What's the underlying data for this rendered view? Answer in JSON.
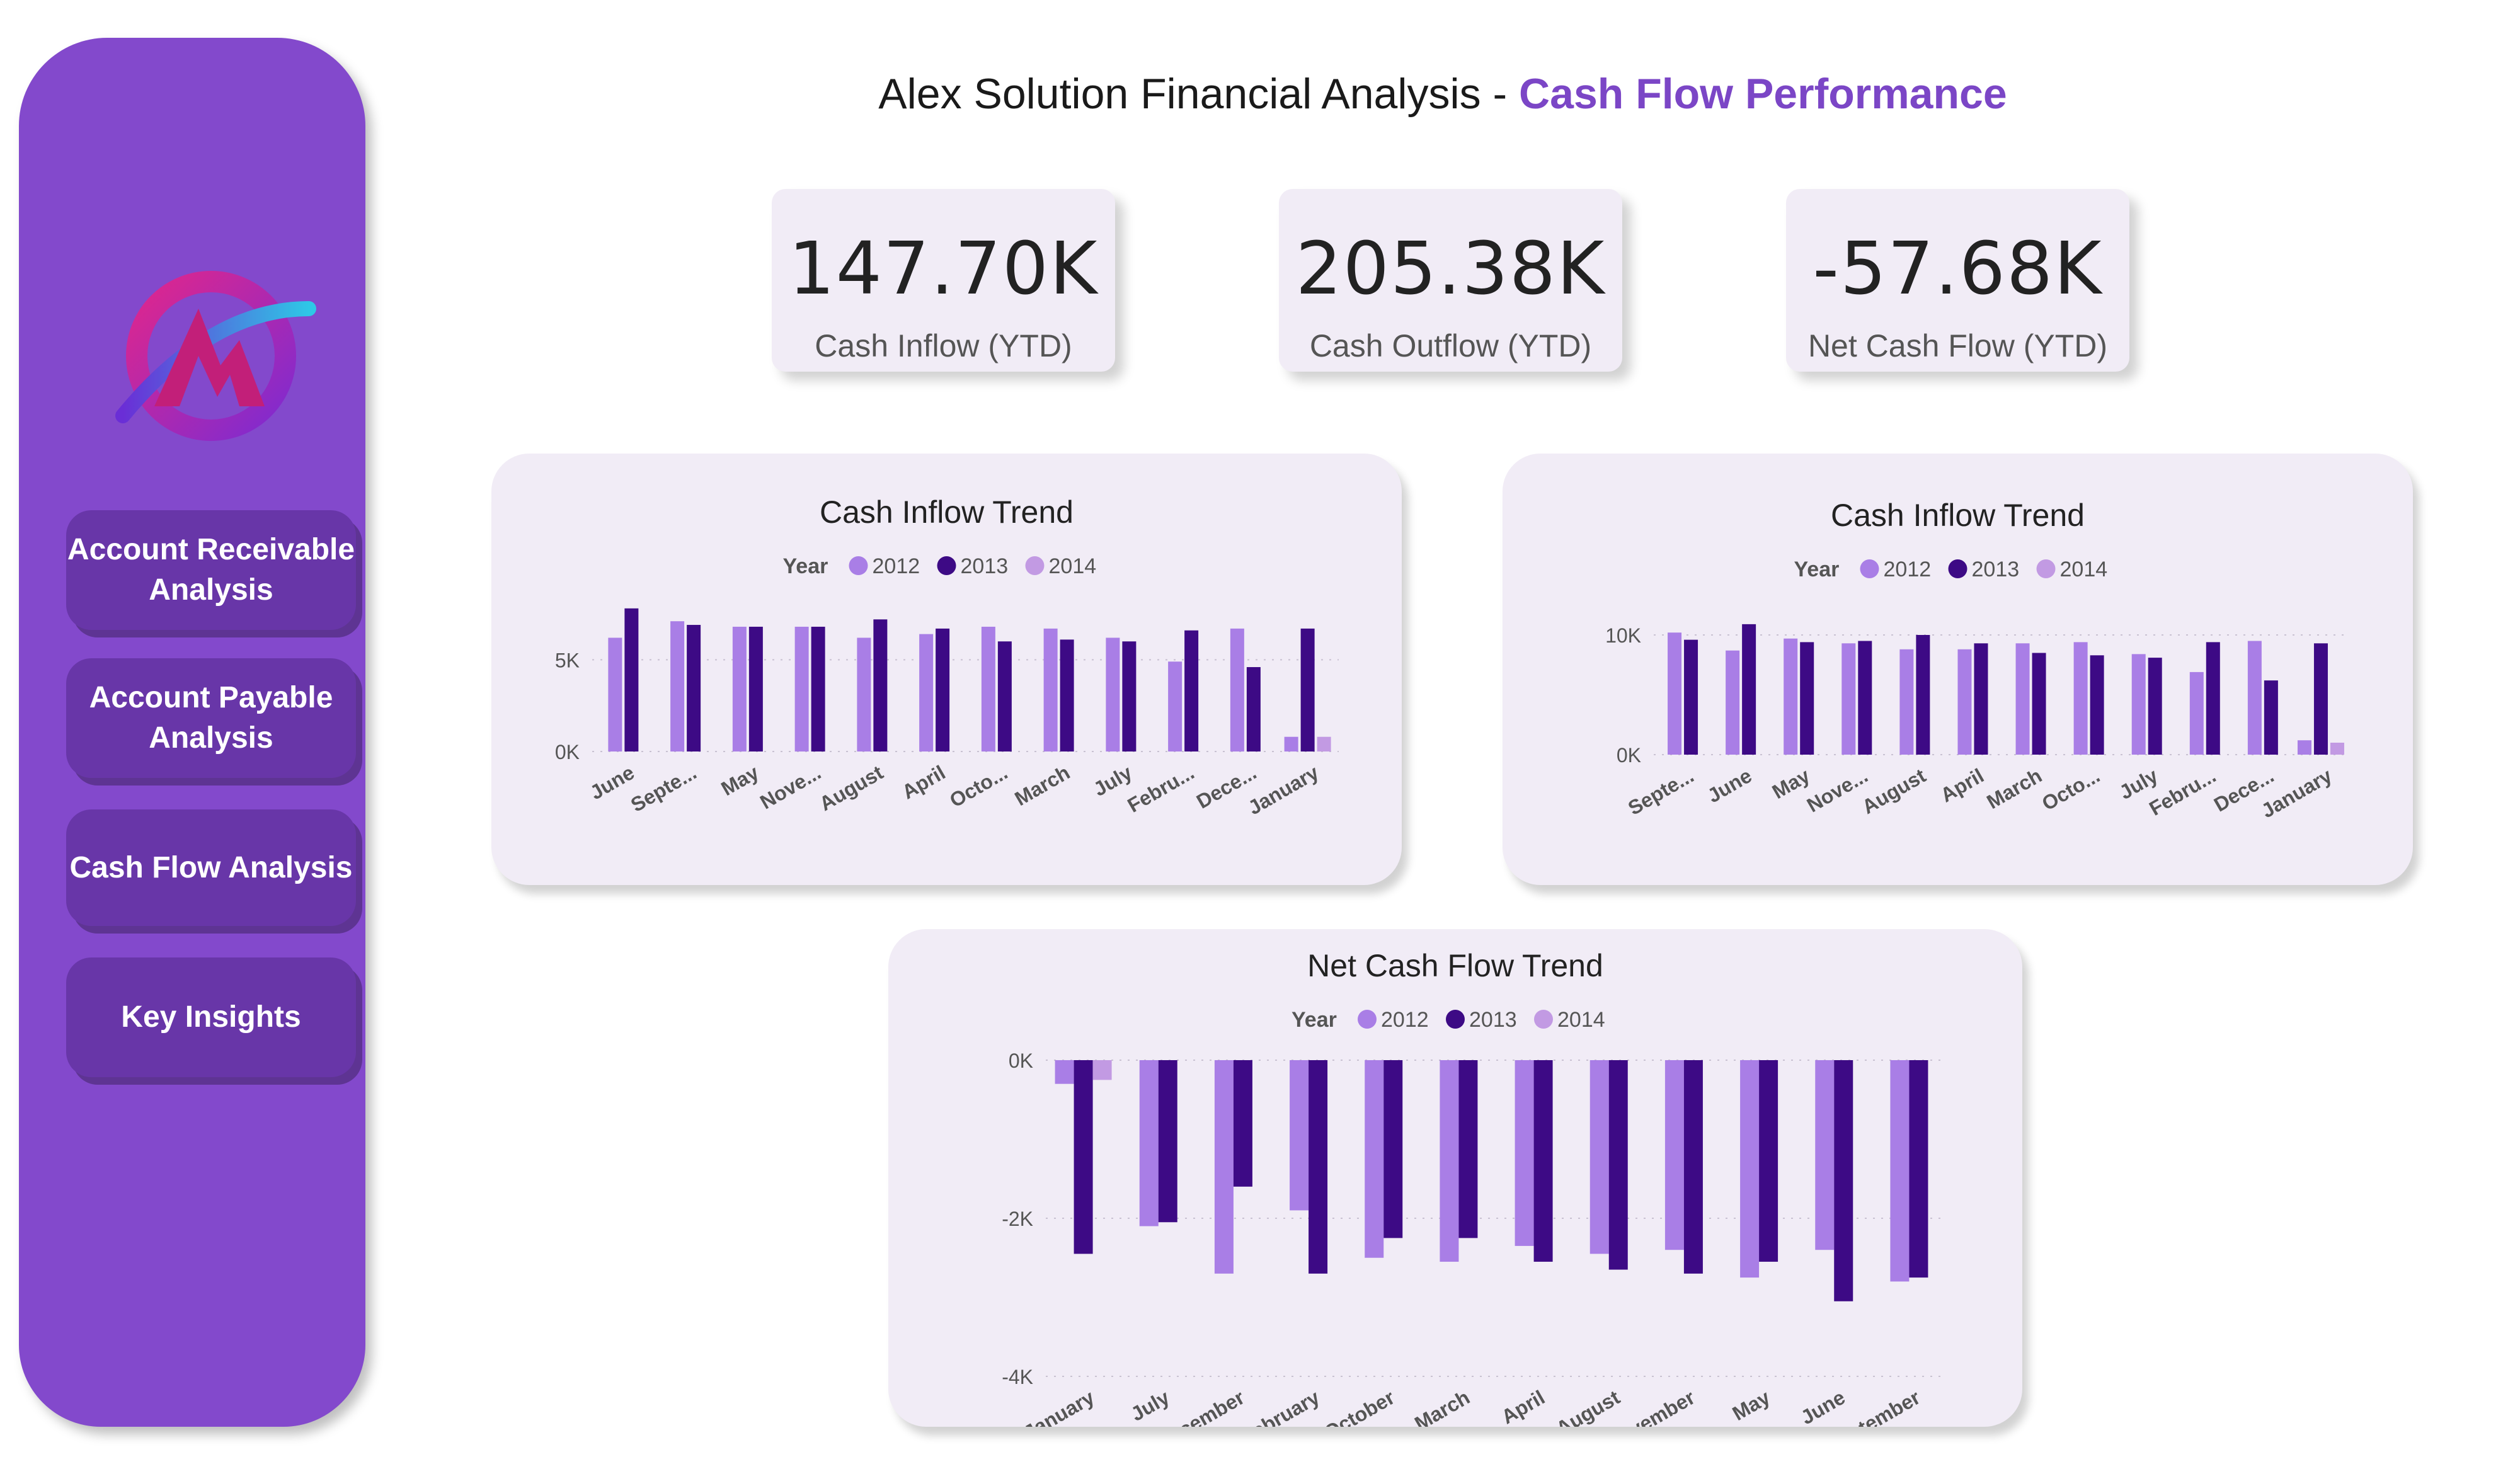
{
  "header": {
    "title_main": "Alex Solution Financial Analysis - ",
    "title_accent": "Cash Flow Performance"
  },
  "colors": {
    "y2012": "#a97ee6",
    "y2013": "#3d0a85",
    "y2014": "#c29ae3",
    "accent": "#7b46c6"
  },
  "sidebar": {
    "logo": "company-logo",
    "items": [
      {
        "line1": "Account Receivable",
        "line2": "Analysis"
      },
      {
        "line1": "Account Payable",
        "line2": "Analysis"
      },
      {
        "line1": "Cash Flow Analysis",
        "line2": ""
      },
      {
        "line1": "Key Insights",
        "line2": ""
      }
    ]
  },
  "kpis": [
    {
      "value": "147.70K",
      "label": "Cash Inflow (YTD)"
    },
    {
      "value": "205.38K",
      "label": "Cash Outflow (YTD)"
    },
    {
      "value": "-57.68K",
      "label": "Net Cash Flow (YTD)"
    }
  ],
  "chart_data": [
    {
      "type": "bar",
      "title": "Cash Inflow Trend",
      "legend_title": "Year",
      "categories": [
        "June",
        "Septe...",
        "May",
        "Nove...",
        "August",
        "April",
        "Octo...",
        "March",
        "July",
        "Febru...",
        "Dece...",
        "January"
      ],
      "series": [
        {
          "name": "2012",
          "values": [
            6200,
            7100,
            6800,
            6800,
            6200,
            6400,
            6800,
            6700,
            6200,
            4900,
            6700,
            800
          ]
        },
        {
          "name": "2013",
          "values": [
            7800,
            6900,
            6800,
            6800,
            7200,
            6700,
            6000,
            6100,
            6000,
            6600,
            4600,
            6700
          ]
        },
        {
          "name": "2014",
          "values": [
            0,
            0,
            0,
            0,
            0,
            0,
            0,
            0,
            0,
            0,
            0,
            800
          ]
        }
      ],
      "yticks": [
        "0K",
        "5K"
      ],
      "ylim": [
        0,
        8000
      ],
      "legend_position": "top"
    },
    {
      "type": "bar",
      "title": "Cash Inflow Trend",
      "legend_title": "Year",
      "categories": [
        "Septe...",
        "June",
        "May",
        "Nove...",
        "August",
        "April",
        "March",
        "Octo...",
        "July",
        "Febru...",
        "Dece...",
        "January"
      ],
      "series": [
        {
          "name": "2012",
          "values": [
            10200,
            8700,
            9700,
            9300,
            8800,
            8800,
            9300,
            9400,
            8400,
            6900,
            9500,
            1200
          ]
        },
        {
          "name": "2013",
          "values": [
            9600,
            10900,
            9400,
            9500,
            10000,
            9300,
            8500,
            8300,
            8100,
            9400,
            6200,
            9300
          ]
        },
        {
          "name": "2014",
          "values": [
            0,
            0,
            0,
            0,
            0,
            0,
            0,
            0,
            0,
            0,
            0,
            1000
          ]
        }
      ],
      "yticks": [
        "0K",
        "10K"
      ],
      "ylim": [
        0,
        12000
      ],
      "legend_position": "top"
    },
    {
      "type": "bar",
      "title": "Net Cash Flow Trend",
      "legend_title": "Year",
      "categories": [
        "January",
        "July",
        "December",
        "February",
        "October",
        "March",
        "April",
        "August",
        "November",
        "May",
        "June",
        "September"
      ],
      "series": [
        {
          "name": "2012",
          "values": [
            -300,
            -2100,
            -2700,
            -1900,
            -2500,
            -2550,
            -2350,
            -2450,
            -2400,
            -2750,
            -2400,
            -2800
          ]
        },
        {
          "name": "2013",
          "values": [
            -2450,
            -2050,
            -1600,
            -2700,
            -2250,
            -2250,
            -2550,
            -2650,
            -2700,
            -2550,
            -3050,
            -2750
          ]
        },
        {
          "name": "2014",
          "values": [
            -250,
            0,
            0,
            0,
            0,
            0,
            0,
            0,
            0,
            0,
            0,
            0
          ]
        }
      ],
      "yticks": [
        "0K",
        "-2K",
        "-4K"
      ],
      "ylim": [
        -4000,
        0
      ],
      "legend_position": "top"
    }
  ]
}
